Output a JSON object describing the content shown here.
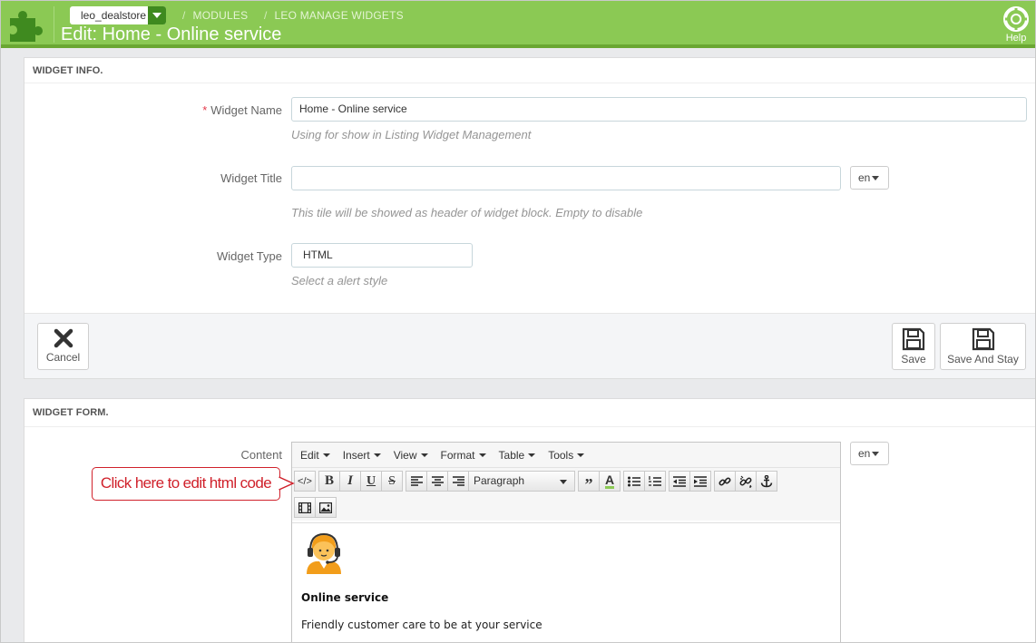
{
  "header": {
    "store": "leo_dealstore",
    "breadcrumb": [
      "MODULES",
      "LEO MANAGE WIDGETS"
    ],
    "title": "Edit: Home - Online service",
    "help_label": "Help",
    "bg_color": "#8bc954"
  },
  "widget_info": {
    "heading": "WIDGET INFO.",
    "name_label": "Widget Name",
    "name_required": "*",
    "name_value": "Home - Online service",
    "name_hint": "Using for show in Listing Widget Management",
    "title_label": "Widget Title",
    "title_value": "",
    "title_lang": "en",
    "title_hint": "This tile will be showed as header of widget block. Empty to disable",
    "type_label": "Widget Type",
    "type_value": "HTML",
    "type_hint": "Select a alert style",
    "cancel_label": "Cancel",
    "save_label": "Save",
    "save_stay_label": "Save And Stay"
  },
  "widget_form": {
    "heading": "WIDGET FORM.",
    "content_label": "Content",
    "content_lang": "en",
    "menu": [
      "Edit",
      "Insert",
      "View",
      "Format",
      "Table",
      "Tools"
    ],
    "format_select": "Paragraph",
    "content_heading": "Online service",
    "content_text": "Friendly customer care to be at your service"
  },
  "callout": {
    "text": "Click here to edit html code",
    "color": "#d0212b"
  }
}
